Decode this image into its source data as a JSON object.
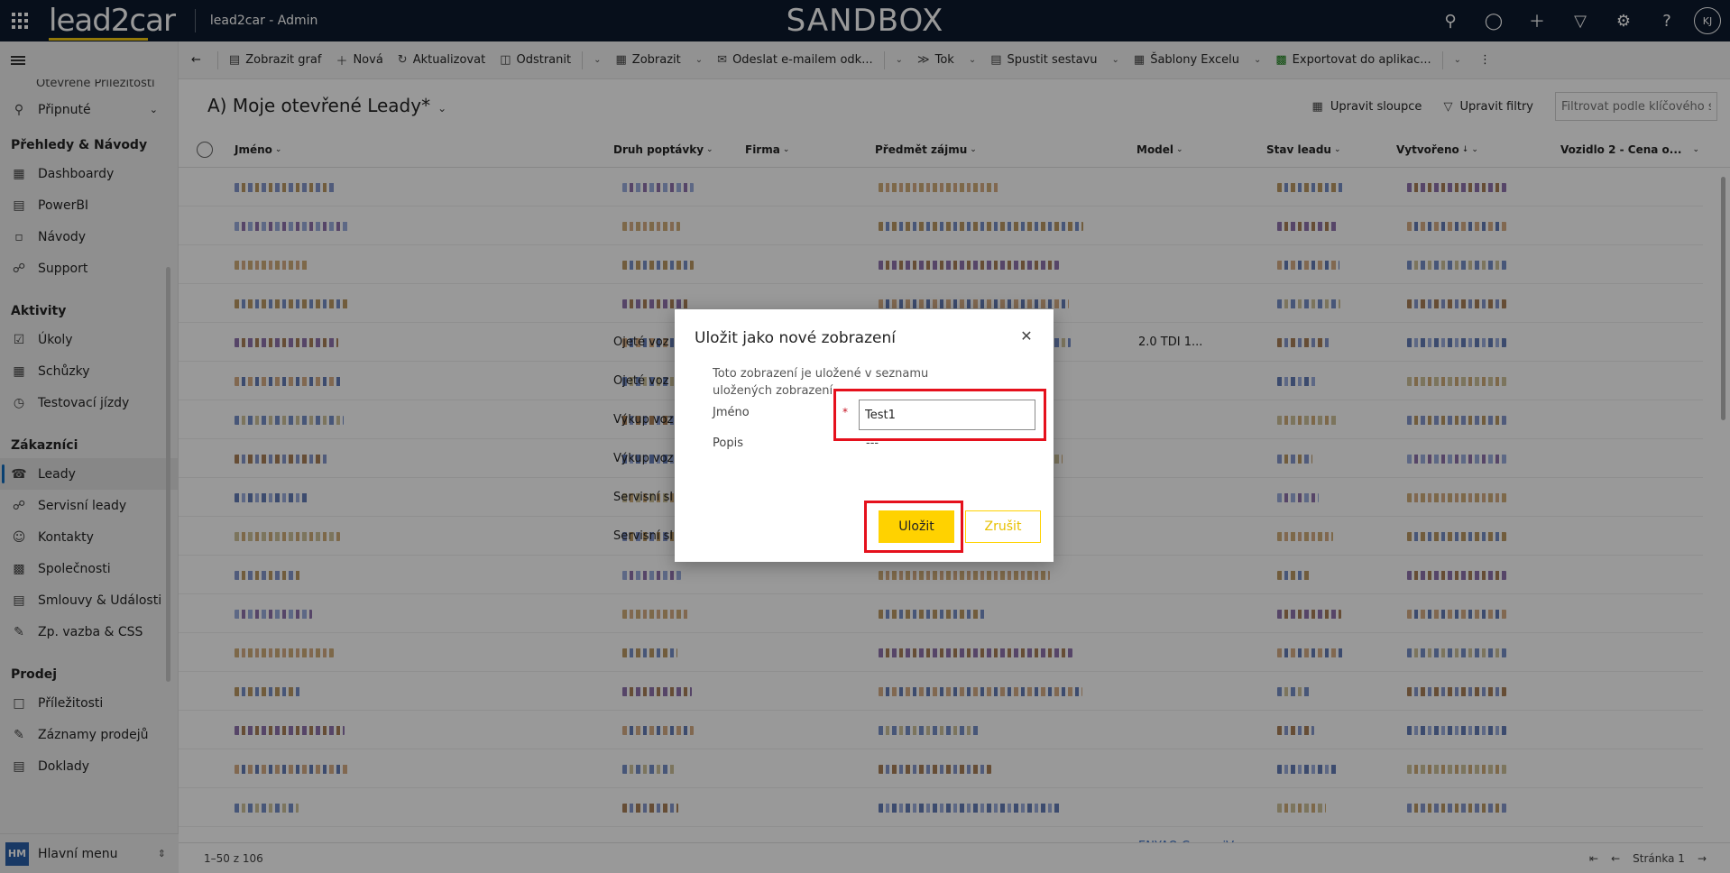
{
  "topbar": {
    "brand": "lead2car",
    "app_name": "lead2car - Admin",
    "environment": "SANDBOX",
    "avatar_initials": "KJ",
    "icons": [
      "search-icon",
      "lightbulb-icon",
      "plus-icon",
      "filter-icon",
      "gear-icon",
      "help-icon"
    ]
  },
  "sidebar": {
    "cut_item": "Otevřené Příležitosti",
    "pinned": "Připnuté",
    "groups": [
      {
        "title": "Přehledy & Návody",
        "items": [
          "Dashboardy",
          "PowerBI",
          "Návody",
          "Support"
        ]
      },
      {
        "title": "Aktivity",
        "items": [
          "Úkoly",
          "Schůzky",
          "Testovací jízdy"
        ]
      },
      {
        "title": "Zákazníci",
        "items": [
          "Leady",
          "Servisní leady",
          "Kontakty",
          "Společnosti",
          "Smlouvy & Události",
          "Zp. vazba & CSS"
        ]
      },
      {
        "title": "Prodej",
        "items": [
          "Příležitosti",
          "Záznamy prodejů",
          "Doklady"
        ]
      }
    ],
    "active_item": "Leady",
    "bottom_badge": "HM",
    "bottom_label": "Hlavní menu"
  },
  "commandbar": {
    "items": [
      "Zobrazit graf",
      "Nová",
      "Aktualizovat",
      "Odstranit",
      "Zobrazit",
      "Odeslat e-mailem odk...",
      "Tok",
      "Spustit sestavu",
      "Šablony Excelu",
      "Exportovat do aplikac..."
    ]
  },
  "view": {
    "title": "A) Moje otevřené Leady*",
    "edit_columns": "Upravit sloupce",
    "edit_filters": "Upravit filtry",
    "filter_placeholder": "Filtrovat podle klíčového slova"
  },
  "grid": {
    "columns": [
      "Jméno",
      "Druh poptávky",
      "Firma",
      "Předmět zájmu",
      "Model",
      "Stav leadu",
      "Vytvořeno",
      "Vozidlo 2 - Cena o..."
    ],
    "visible_cells": [
      {
        "row": 4,
        "col": "Druh poptávky",
        "text": "Ojeté voz"
      },
      {
        "row": 4,
        "col": "Model",
        "text": "2.0 TDI 1..."
      },
      {
        "row": 5,
        "col": "Druh poptávky",
        "text": "Ojeté voz"
      },
      {
        "row": 6,
        "col": "Druh poptávky",
        "text": "Výkup voz"
      },
      {
        "row": 7,
        "col": "Druh poptávky",
        "text": "Výkup voz"
      },
      {
        "row": 8,
        "col": "Druh poptávky",
        "text": "Servisní sl"
      },
      {
        "row": 9,
        "col": "Druh poptávky",
        "text": "Servisní sl"
      },
      {
        "row": 17,
        "col": "Model",
        "text": "ENYAQ Coupe iV"
      }
    ],
    "pagination_count": "1–50 z 106",
    "page_label": "Stránka 1"
  },
  "dialog": {
    "title": "Uložit jako nové zobrazení",
    "description": "Toto zobrazení je uložené v seznamu uložených zobrazení.",
    "name_label": "Jméno",
    "name_required": "*",
    "name_value": "Test1",
    "desc_label": "Popis",
    "desc_value": "---",
    "save_label": "Uložit",
    "cancel_label": "Zrušit"
  },
  "colors": {
    "topbar": "#0c1a2e",
    "accent_yellow": "#ffd200",
    "highlight_red": "#e5101c"
  }
}
